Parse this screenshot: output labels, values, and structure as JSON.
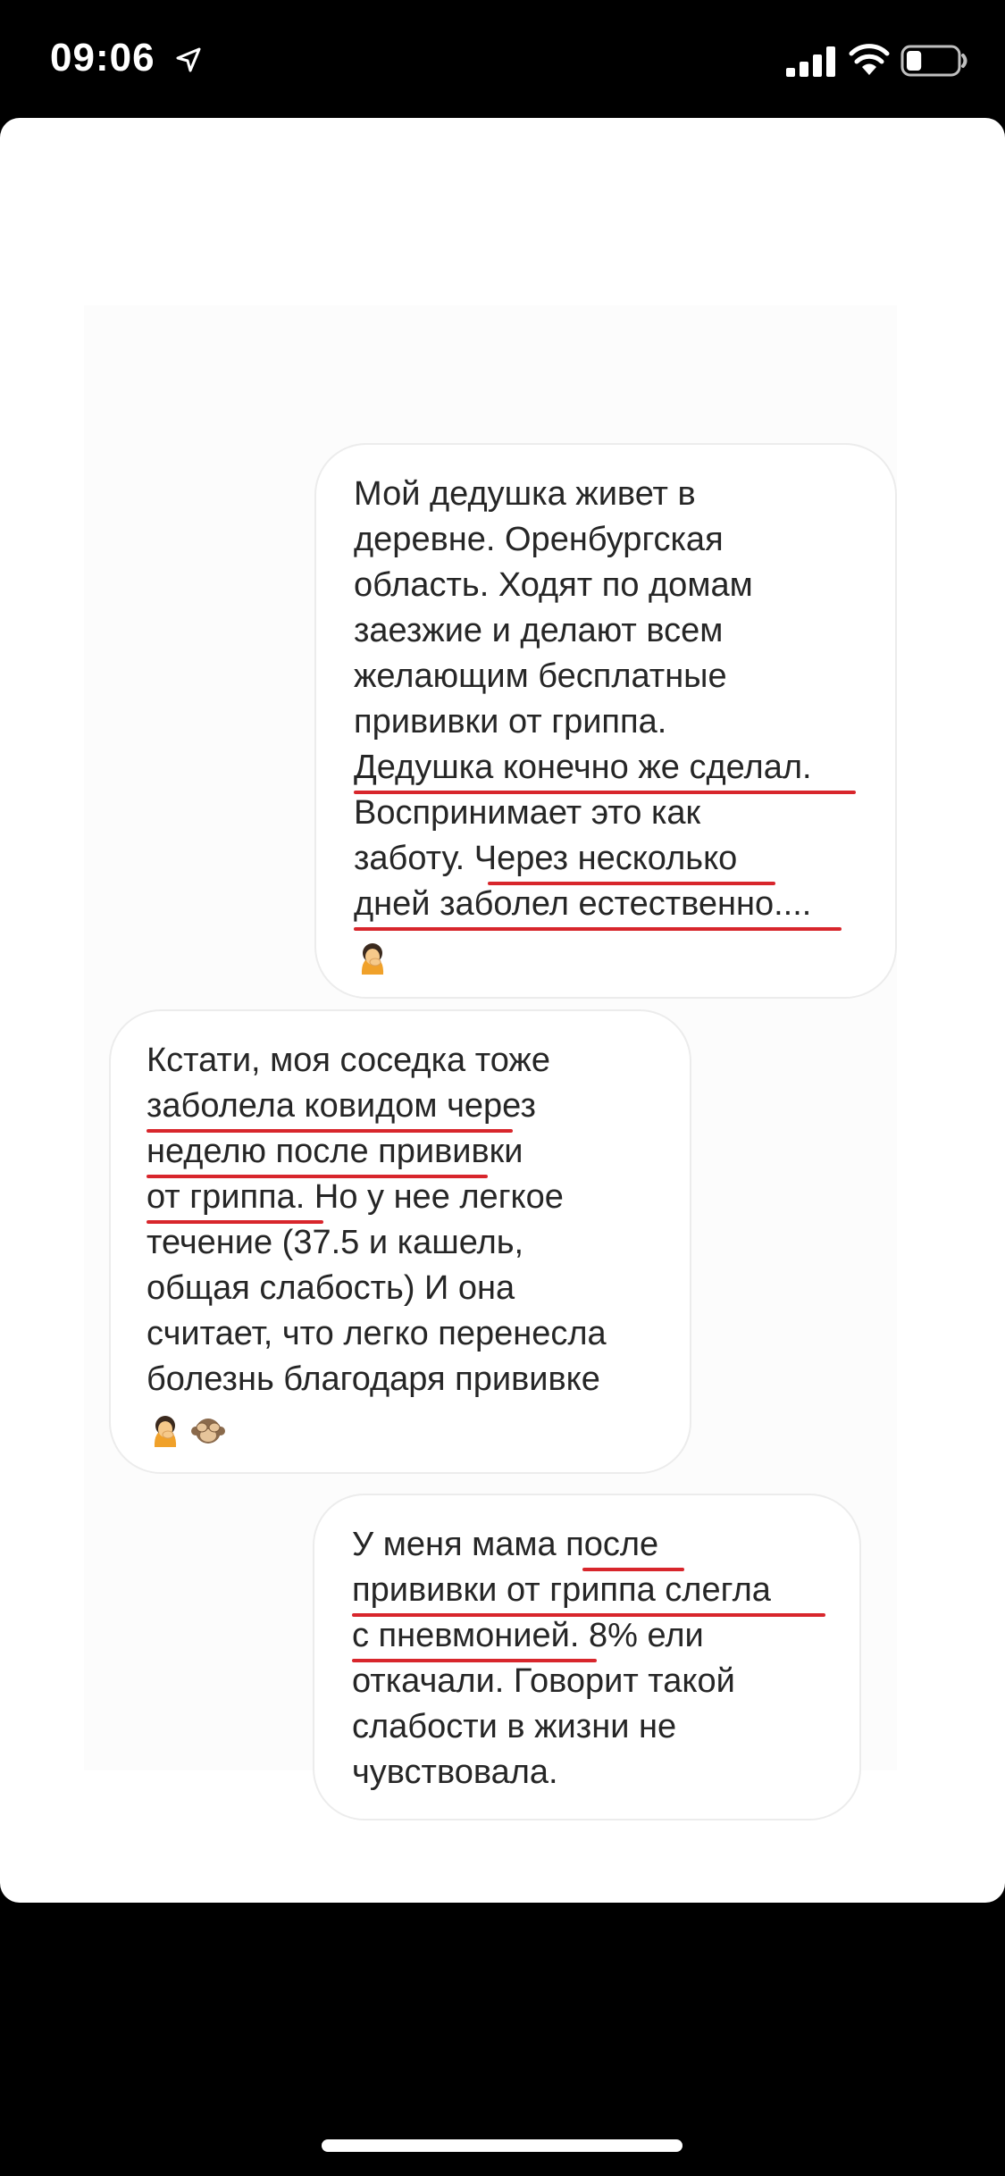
{
  "status_bar": {
    "time": "09:06",
    "icons": [
      "location-arrow-icon",
      "cellular-signal-icon",
      "wifi-icon",
      "battery-icon"
    ],
    "battery_level": 0.3
  },
  "messages": [
    {
      "side": "right",
      "text": "Мой дедушка живет в\nдеревне. Оренбургская\nобласть. Ходят по домам\nзаезжие и делают всем\nжелающим бесплатные\nпрививки от гриппа.\nДедушка конечно же сделал.\nВоспринимает это как\nзаботу. Через несколько\nдней заболел естественно....",
      "emoji": [
        "woman-facepalm-emoji"
      ]
    },
    {
      "side": "left",
      "text": "Кстати, моя соседка тоже\nзаболела ковидом через\nнеделю после прививки\nот гриппа. Но у нее легкое\nтечение (37.5 и кашель,\nобщая слабость) И она\nсчитает, что легко перенесла\nболезнь благодаря прививке",
      "emoji": [
        "woman-facepalm-emoji",
        "see-no-evil-monkey-emoji"
      ]
    },
    {
      "side": "right",
      "text": "У меня мама после\nпрививки от гриппа слегла\nс пневмонией. 8% ели\nоткачали. Говорит такой\nслабости в жизни не\nчувствовала.",
      "emoji": []
    }
  ],
  "colors": {
    "underline": "#d8262c",
    "text": "#262626",
    "bubble_border": "#ececec"
  }
}
